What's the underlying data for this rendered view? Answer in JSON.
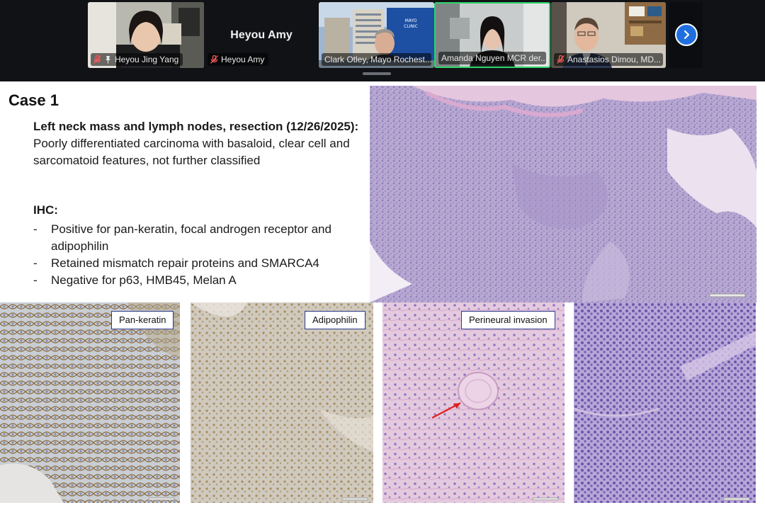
{
  "participants": [
    {
      "name": "Heyou Jing Yang",
      "muted": true,
      "pinned": true
    },
    {
      "name": "Heyou Amy",
      "display_name": "Heyou Amy",
      "muted": true
    },
    {
      "name": "Clark Otley, Mayo Rochest...",
      "muted": false
    },
    {
      "name": "Amanda Nguyen MCR der...",
      "muted": false,
      "active_speaker": true
    },
    {
      "name": "Anastasios Dimou, MD...",
      "muted": true
    }
  ],
  "colors": {
    "active_speaker_border": "#2fd36a",
    "next_button": "#1f6fe0",
    "label_border": "#2d3b8c"
  },
  "slide": {
    "title": "Case 1",
    "case_heading": "Left neck mass and lymph nodes, resection (12/26/2025):",
    "case_text": "Poorly differentiated carcinoma with basaloid, clear cell and sarcomatoid features, not further classified",
    "ihc_heading": "IHC:",
    "ihc_items": [
      "Positive for pan-keratin, focal androgen receptor and adipophilin",
      "Retained mismatch repair proteins and SMARCA4",
      "Negative for p63, HMB45, Melan A"
    ],
    "image_labels": {
      "pan_keratin": "Pan-keratin",
      "adipophilin": "Adipophilin",
      "perineural": "Perineural invasion"
    }
  }
}
